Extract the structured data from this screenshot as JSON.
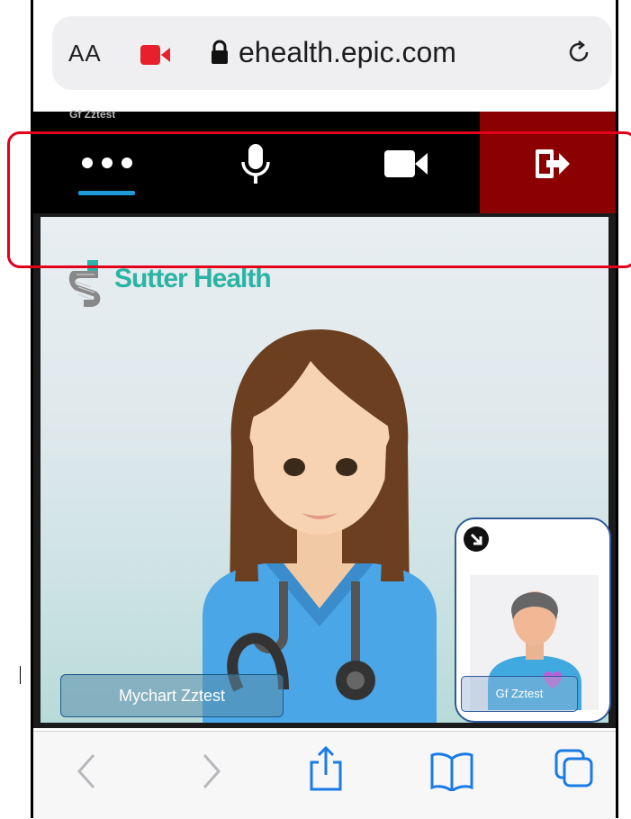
{
  "browser": {
    "text_size_label": "AA",
    "url": "ehealth.epic.com"
  },
  "toolbar": {
    "caption": "Gf Zztest",
    "exit_color": "#8b0000",
    "active_underline_color": "#1e9ad6"
  },
  "stage": {
    "brand": "Sutter Health",
    "main_participant": "Mychart Zztest",
    "self_view_participant": "Gf Zztest"
  },
  "icons": {
    "text_size": "text-size-icon",
    "camera_active": "video-camera-indicator-icon",
    "lock": "lock-icon",
    "reload": "reload-icon",
    "more": "more-options-icon",
    "mic": "microphone-icon",
    "video": "video-camera-icon",
    "leave": "leave-call-icon",
    "back": "back-arrow-icon",
    "forward": "forward-arrow-icon",
    "share": "share-icon",
    "bookmarks": "bookmarks-icon",
    "tabs": "tabs-icon",
    "expand": "expand-self-view-icon"
  }
}
